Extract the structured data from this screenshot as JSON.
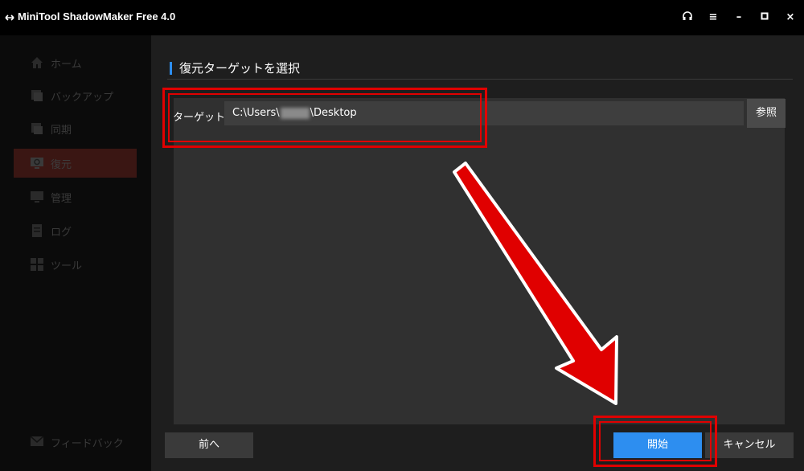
{
  "titlebar": {
    "title": "MiniTool ShadowMaker Free 4.0",
    "buttons": [
      "headphones-icon",
      "menu-icon",
      "minimize-icon",
      "maximize-icon",
      "close-icon"
    ]
  },
  "sidebar": {
    "items": [
      {
        "label": "ホーム",
        "icon": "home-icon"
      },
      {
        "label": "バックアップ",
        "icon": "backup-icon"
      },
      {
        "label": "同期",
        "icon": "sync-icon"
      },
      {
        "label": "復元",
        "icon": "restore-icon",
        "active": true
      },
      {
        "label": "管理",
        "icon": "manage-icon"
      },
      {
        "label": "ログ",
        "icon": "log-icon"
      },
      {
        "label": "ツール",
        "icon": "tools-icon"
      }
    ],
    "feedback_label": "フィードバック"
  },
  "main": {
    "section_title": "復元ターゲットを選択",
    "target_label": "ターゲット:",
    "path_prefix": "C:\\Users\\",
    "path_suffix": "\\Desktop",
    "browse_label": "参照",
    "back_label": "前へ",
    "start_label": "開始",
    "cancel_label": "キャンセル"
  },
  "colors": {
    "accent": "#2d8ef0",
    "annotation": "#e00000",
    "active_nav": "#3a1613"
  }
}
